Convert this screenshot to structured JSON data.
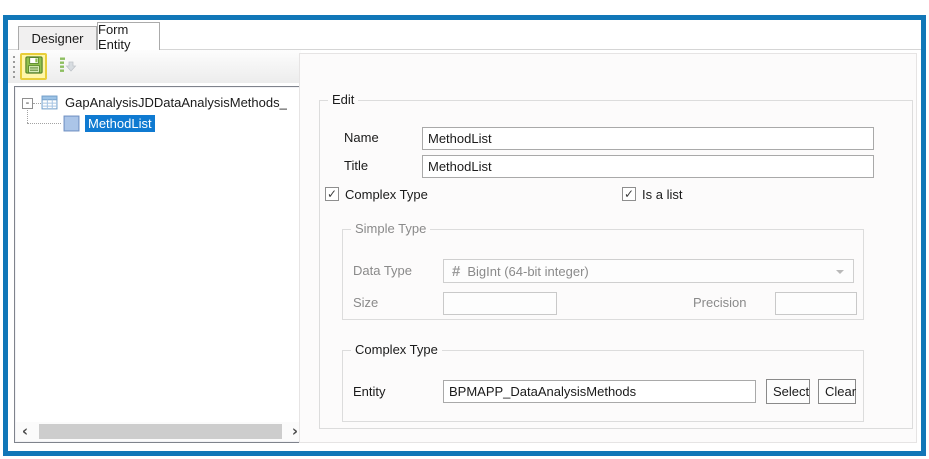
{
  "colors": {
    "frame_blue": "#1177b8",
    "selection_blue": "#0f7ad1",
    "save_button_highlight": "#fff7a8",
    "save_button_border": "#e8ce3a",
    "disabled_text": "#8a8a8a"
  },
  "tabs": {
    "designer": "Designer",
    "form_entity": "Form Entity"
  },
  "toolbar": {
    "save_icon": "save-floppy-icon",
    "apply_icon": "apply-down-icon"
  },
  "tree": {
    "expander_glyph": "-",
    "root_label": "GapAnalysisJDDataAnalysisMethods_",
    "child_label": "MethodList",
    "child_selected": true,
    "scrollbar": {
      "left_glyph": "‹",
      "right_glyph": "›"
    }
  },
  "edit": {
    "legend": "Edit",
    "name_label": "Name",
    "name_value": "MethodList",
    "title_label": "Title",
    "title_value": "MethodList",
    "complex_type_checkbox": {
      "label": "Complex Type",
      "checked": true,
      "glyph": "✓"
    },
    "is_a_list_checkbox": {
      "label": "Is a list",
      "checked": true,
      "glyph": "✓"
    },
    "simple_type": {
      "legend": "Simple Type",
      "disabled": true,
      "data_type_label": "Data Type",
      "data_type_icon_glyph": "#",
      "data_type_value": "BigInt (64-bit integer)",
      "size_label": "Size",
      "size_value": "",
      "precision_label": "Precision",
      "precision_value": ""
    },
    "complex_type_group": {
      "legend": "Complex Type",
      "entity_label": "Entity",
      "entity_value": "BPMAPP_DataAnalysisMethods",
      "select_button": "Select",
      "clear_button": "Clear"
    }
  }
}
